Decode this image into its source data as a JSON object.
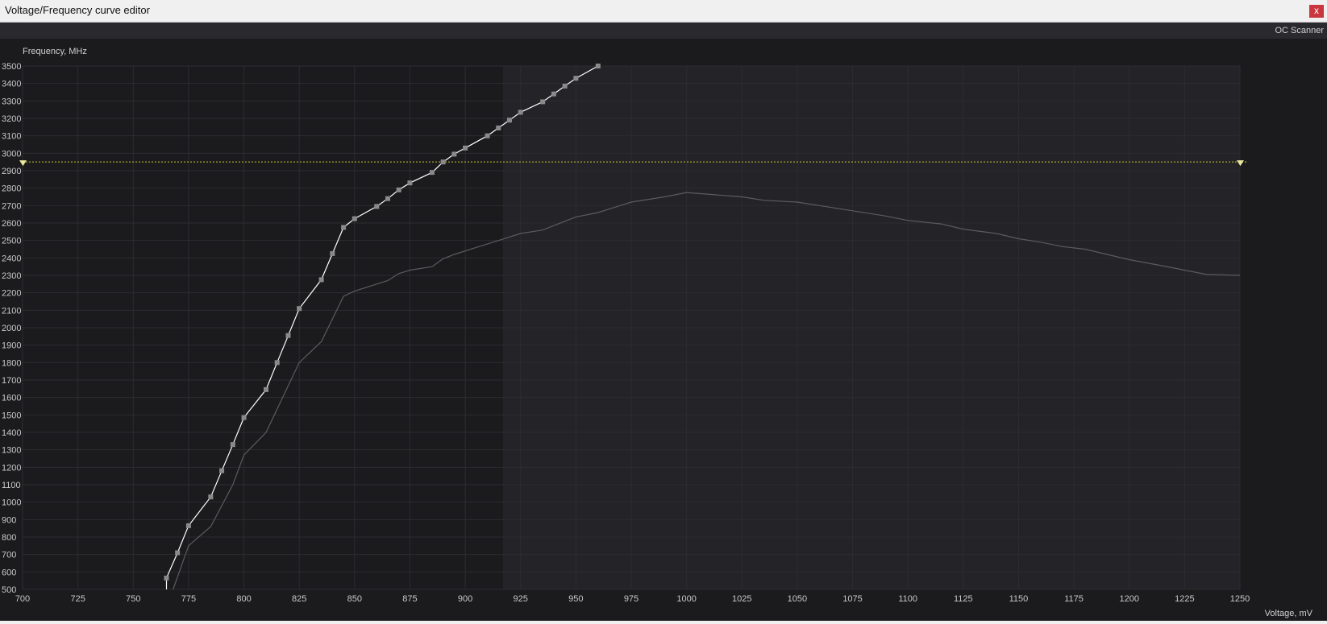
{
  "window": {
    "title": "Voltage/Frequency curve editor",
    "close_label": "x"
  },
  "toolbar": {
    "oc_scanner_label": "OC Scanner"
  },
  "chart_data": {
    "type": "line",
    "ylabel": "Frequency, MHz",
    "xlabel": "Voltage, mV",
    "xlim": [
      700,
      1250
    ],
    "ylim": [
      500,
      3500
    ],
    "x_ticks": [
      700,
      725,
      750,
      775,
      800,
      825,
      850,
      875,
      900,
      925,
      950,
      975,
      1000,
      1025,
      1050,
      1075,
      1100,
      1125,
      1150,
      1175,
      1200,
      1225,
      1250
    ],
    "y_ticks": [
      500,
      600,
      700,
      800,
      900,
      1000,
      1100,
      1200,
      1300,
      1400,
      1500,
      1600,
      1700,
      1800,
      1900,
      2000,
      2100,
      2200,
      2300,
      2400,
      2500,
      2600,
      2700,
      2800,
      2900,
      3000,
      3100,
      3200,
      3300,
      3400,
      3500
    ],
    "grid": true,
    "highlight_region_start_x": 917,
    "limit_line_y": 2950,
    "colors": {
      "curve": "#ffffff",
      "points": "#8a8a8a",
      "base_curve": "#5c5c60",
      "limit_line": "#c8c834",
      "background": "#1b1b1e",
      "highlight": "#232328"
    },
    "series": [
      {
        "role": "edited-curve",
        "points": [
          [
            765,
            500
          ],
          [
            765,
            565
          ],
          [
            770,
            710
          ],
          [
            775,
            865
          ],
          [
            785,
            1030
          ],
          [
            790,
            1180
          ],
          [
            795,
            1330
          ],
          [
            800,
            1485
          ],
          [
            810,
            1645
          ],
          [
            815,
            1800
          ],
          [
            820,
            1955
          ],
          [
            825,
            2110
          ],
          [
            835,
            2275
          ],
          [
            840,
            2425
          ],
          [
            845,
            2575
          ],
          [
            850,
            2625
          ],
          [
            860,
            2695
          ],
          [
            865,
            2740
          ],
          [
            870,
            2790
          ],
          [
            875,
            2830
          ],
          [
            885,
            2890
          ],
          [
            890,
            2950
          ],
          [
            895,
            2995
          ],
          [
            900,
            3030
          ],
          [
            910,
            3100
          ],
          [
            915,
            3145
          ],
          [
            920,
            3190
          ],
          [
            925,
            3235
          ],
          [
            935,
            3295
          ],
          [
            940,
            3340
          ],
          [
            945,
            3385
          ],
          [
            950,
            3430
          ],
          [
            960,
            3500
          ]
        ]
      },
      {
        "role": "base-curve",
        "points": [
          [
            768,
            500
          ],
          [
            775,
            750
          ],
          [
            785,
            860
          ],
          [
            795,
            1100
          ],
          [
            800,
            1270
          ],
          [
            810,
            1400
          ],
          [
            825,
            1800
          ],
          [
            835,
            1920
          ],
          [
            845,
            2180
          ],
          [
            850,
            2210
          ],
          [
            860,
            2250
          ],
          [
            865,
            2270
          ],
          [
            870,
            2310
          ],
          [
            875,
            2330
          ],
          [
            885,
            2350
          ],
          [
            890,
            2395
          ],
          [
            895,
            2420
          ],
          [
            905,
            2460
          ],
          [
            915,
            2500
          ],
          [
            925,
            2540
          ],
          [
            935,
            2560
          ],
          [
            945,
            2610
          ],
          [
            950,
            2635
          ],
          [
            960,
            2660
          ],
          [
            970,
            2700
          ],
          [
            975,
            2720
          ],
          [
            990,
            2750
          ],
          [
            1000,
            2775
          ],
          [
            1025,
            2750
          ],
          [
            1035,
            2730
          ],
          [
            1050,
            2720
          ],
          [
            1060,
            2700
          ],
          [
            1075,
            2670
          ],
          [
            1090,
            2640
          ],
          [
            1100,
            2615
          ],
          [
            1115,
            2595
          ],
          [
            1125,
            2565
          ],
          [
            1140,
            2540
          ],
          [
            1150,
            2510
          ],
          [
            1160,
            2490
          ],
          [
            1170,
            2465
          ],
          [
            1180,
            2450
          ],
          [
            1190,
            2420
          ],
          [
            1200,
            2390
          ],
          [
            1215,
            2355
          ],
          [
            1225,
            2330
          ],
          [
            1235,
            2305
          ],
          [
            1250,
            2300
          ]
        ]
      }
    ]
  }
}
